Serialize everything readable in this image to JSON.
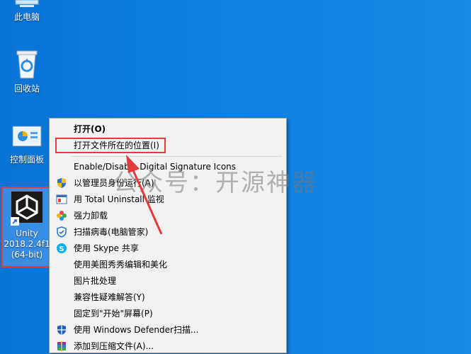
{
  "desktop": {
    "icons": [
      {
        "label": "此电脑",
        "icon": "computer-icon"
      },
      {
        "label": "回收站",
        "icon": "recycle-bin-icon"
      },
      {
        "label": "控制面板",
        "icon": "control-panel-icon"
      },
      {
        "label_lines": [
          "Unity",
          "2018.2.4f1",
          "(64-bit)"
        ],
        "icon": "unity-icon"
      }
    ]
  },
  "context_menu": {
    "items": [
      {
        "label": "打开(O)",
        "bold": true,
        "icon": ""
      },
      {
        "label": "打开文件所在的位置(I)",
        "icon": ""
      },
      {
        "label": "Enable/Disable Digital Signature Icons",
        "icon": ""
      },
      {
        "label": "以管理员身份运行(A)",
        "icon": "uac-shield-icon"
      },
      {
        "label": "用 Total Uninstall 监视",
        "icon": "total-uninstall-icon"
      },
      {
        "label": "强力卸载",
        "icon": "uninstall-icon"
      },
      {
        "label": "扫描病毒(电脑管家)",
        "icon": "scan-shield-icon"
      },
      {
        "label": "使用 Skype 共享",
        "icon": "skype-icon"
      },
      {
        "label": "使用美图秀秀编辑和美化",
        "icon": ""
      },
      {
        "label": "图片批处理",
        "icon": ""
      },
      {
        "label": "兼容性疑难解答(Y)",
        "icon": ""
      },
      {
        "label": "固定到\"开始\"屏幕(P)",
        "icon": ""
      },
      {
        "label": "使用 Windows Defender扫描...",
        "icon": "defender-icon"
      },
      {
        "label": "添加到压缩文件(A)...",
        "icon": "winrar-icon"
      }
    ]
  },
  "watermark": "公众号：开源神器",
  "colors": {
    "highlight": "#e43b3b",
    "desktop": "#0d7fe0"
  }
}
